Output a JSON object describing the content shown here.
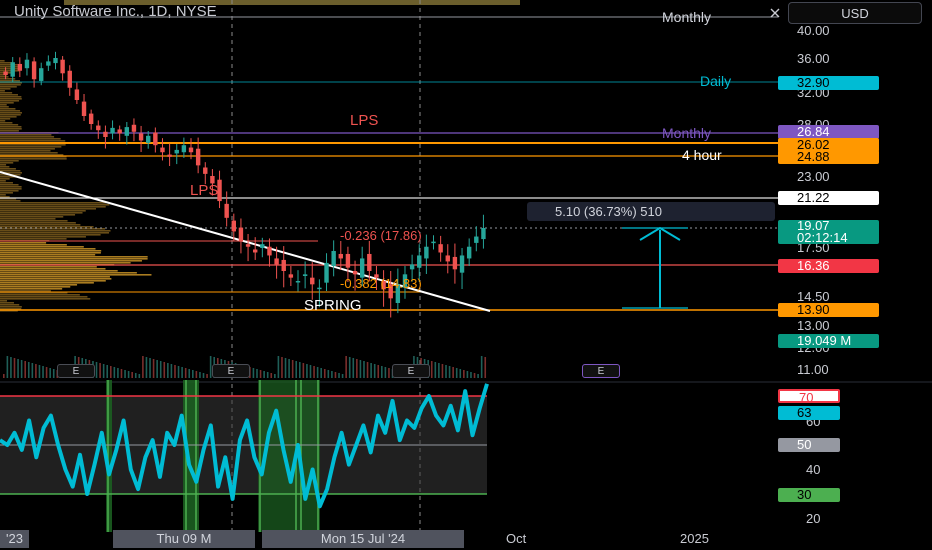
{
  "header": {
    "symbol_line": "Unity Software Inc., 1D, NYSE",
    "currency": "USD"
  },
  "price_axis": {
    "ticks": [
      "40.00",
      "36.00",
      "32.00",
      "28.00",
      "23.00",
      "17.50",
      "14.50",
      "13.00",
      "12.00",
      "11.00"
    ]
  },
  "level_labels": {
    "monthly_top": "Monthly",
    "daily": "Daily",
    "monthly_mid": "Monthly",
    "four_hour": "4 hour"
  },
  "price_badges": {
    "daily": "32.90",
    "monthly": "26.84",
    "orange_1": "26.02",
    "orange_2": "24.88",
    "white": "21.22",
    "last_price": "19.07",
    "countdown": "02:12:14",
    "red": "16.36",
    "orange_low": "13.90",
    "volume": "19.049 M"
  },
  "annotations": {
    "lps_top": "LPS",
    "lps_bottom": "LPS",
    "spring": "SPRING",
    "measure_up": "-0.236 (17.86)",
    "measure_down": "-0.382 (14.83)",
    "range_box": "5.10 (36.73%) 510"
  },
  "earnings_marks": [
    "E",
    "E",
    "E",
    "E"
  ],
  "rsi": {
    "axis_ticks": [
      "60",
      "40",
      "20"
    ],
    "badges": {
      "upper": "70",
      "value": "63",
      "mid": "50",
      "lower": "30"
    }
  },
  "time_axis": {
    "labels": [
      "'23",
      "Thu 09 M",
      "Mon 15 Jul '24",
      "Oct",
      "2025"
    ]
  },
  "colors": {
    "up": "#26a69a",
    "down": "#ef5350",
    "rsi_line": "#00bcd4",
    "orange": "#ff9800",
    "purple": "#7e57c2",
    "teal": "#00bcd4",
    "green_band": "#4caf50",
    "red_band": "#f23645"
  },
  "chart_data": {
    "type": "candlestick",
    "title": "",
    "series": [
      {
        "name": "",
        "description": "approximate daily closes",
        "values": [
          34.0,
          35.5,
          34.5,
          35.8,
          33.5,
          34.8,
          35.6,
          36.0,
          34.2,
          32.5,
          31.0,
          29.0,
          28.0,
          27.2,
          26.5,
          27.5,
          26.8,
          27.6,
          27.0,
          26.2,
          26.6,
          25.8,
          25.2,
          24.8,
          25.4,
          25.8,
          25.2,
          24.0,
          23.2,
          22.4,
          21.0,
          19.8,
          18.8,
          18.0,
          17.6,
          17.2,
          17.8,
          17.0,
          16.4,
          16.0,
          15.6,
          15.4,
          15.8,
          15.2,
          15.0,
          16.5,
          17.3,
          16.8,
          16.2,
          15.8,
          16.8,
          16.0,
          15.6,
          14.9,
          14.4,
          15.2,
          15.8,
          16.4,
          17.0,
          17.6,
          18.0,
          17.2,
          16.6,
          16.1,
          17.0,
          17.6,
          18.4,
          19.07
        ]
      }
    ],
    "ylim": [
      11,
      40
    ],
    "rsi": {
      "levels": [
        70,
        50,
        30
      ],
      "last_value": 63
    }
  }
}
